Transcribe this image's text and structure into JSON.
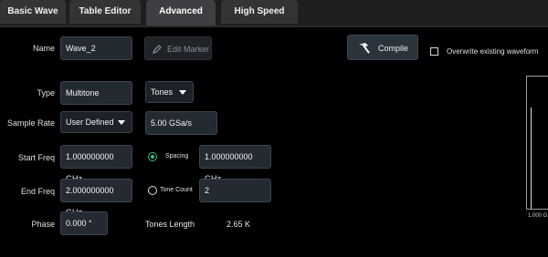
{
  "tabs": [
    {
      "label": "Basic Wave"
    },
    {
      "label": "Table Editor"
    },
    {
      "label": "Advanced",
      "active": true
    },
    {
      "label": "High Speed Serial"
    }
  ],
  "form": {
    "name_label": "Name",
    "name_value": "Wave_2",
    "edit_marker_label": "Edit Marker",
    "compile_label": "Compile",
    "overwrite_label": "Overwrite existing waveform",
    "overwrite_checked": false,
    "type_label": "Type",
    "type_value": "Multitone",
    "tones_value": "Tones",
    "sample_rate_label": "Sample Rate",
    "sample_rate_mode": "User Defined",
    "sample_rate_value": "5.00 GSa/s",
    "start_freq_label": "Start Freq",
    "start_freq_value": "1.000000000 GHz",
    "spacing_label": "Spacing",
    "spacing_selected": true,
    "spacing_value": "1.000000000 GHz",
    "end_freq_label": "End Freq",
    "end_freq_value": "2.000000000 GHz",
    "tone_count_label": "Tone Count",
    "tone_count_selected": false,
    "tone_count_value": "2",
    "phase_label": "Phase",
    "phase_value": "0.000 °",
    "tones_length_label": "Tones Length",
    "tones_length_value": "2.65 K"
  },
  "preview": {
    "axis_label": "1.000 G"
  },
  "colors": {
    "accent_green": "#39c08a",
    "panel_bg": "#000000",
    "field_bg": "#242a31"
  }
}
